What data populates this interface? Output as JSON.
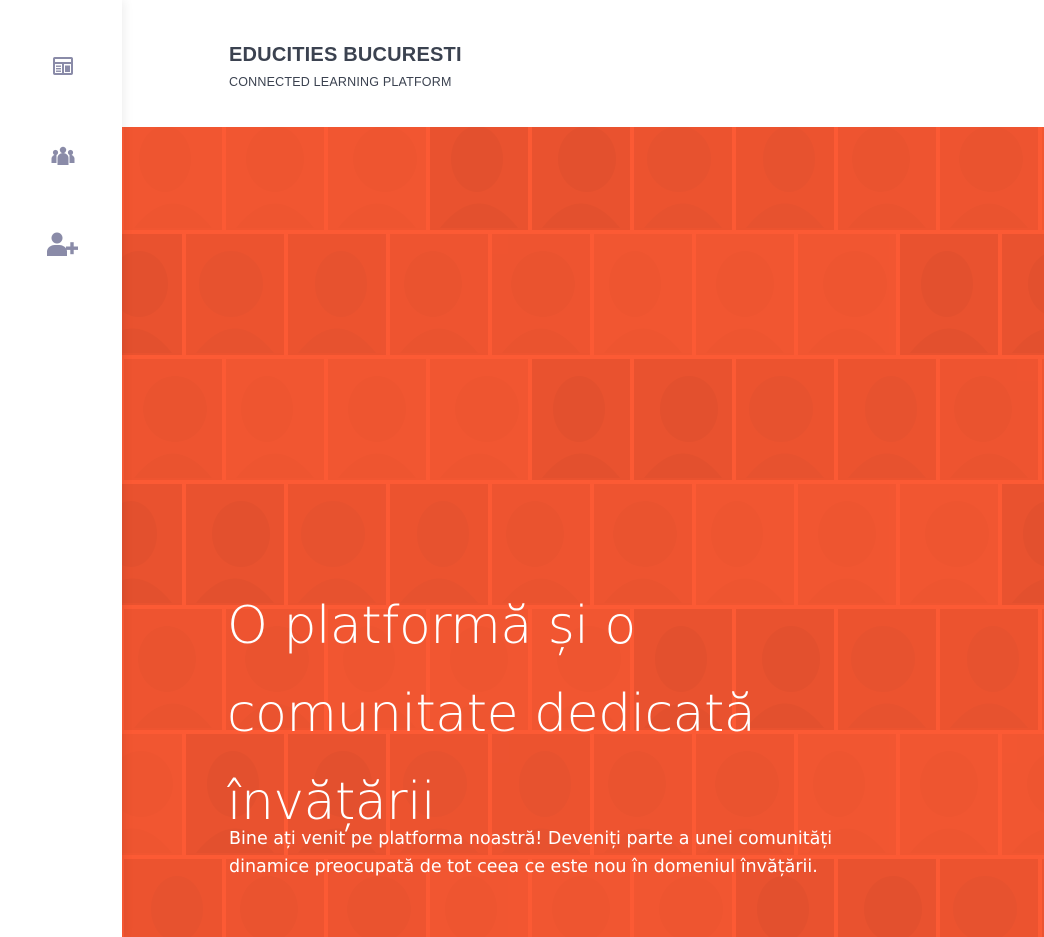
{
  "sidebar": {
    "items": [
      {
        "icon": "dashboard-icon",
        "label": "Dashboard"
      },
      {
        "icon": "community-icon",
        "label": "Community"
      },
      {
        "icon": "add-user-icon",
        "label": "Register"
      }
    ],
    "icon_color": "#8a8ba8"
  },
  "header": {
    "title": "EDUCITIES BUCURESTI",
    "subtitle": "CONNECTED LEARNING PLATFORM"
  },
  "hero": {
    "title_lines": [
      "O platformă și o",
      "comunitate dedicată",
      "învățării"
    ],
    "description_lines": [
      "Bine ați venit pe platforma noastră! Deveniți parte a unei comunități",
      "dinamice preocupată de tot ceea ce este nou în domeniul învățării."
    ],
    "background_color": "#fc5a34"
  }
}
